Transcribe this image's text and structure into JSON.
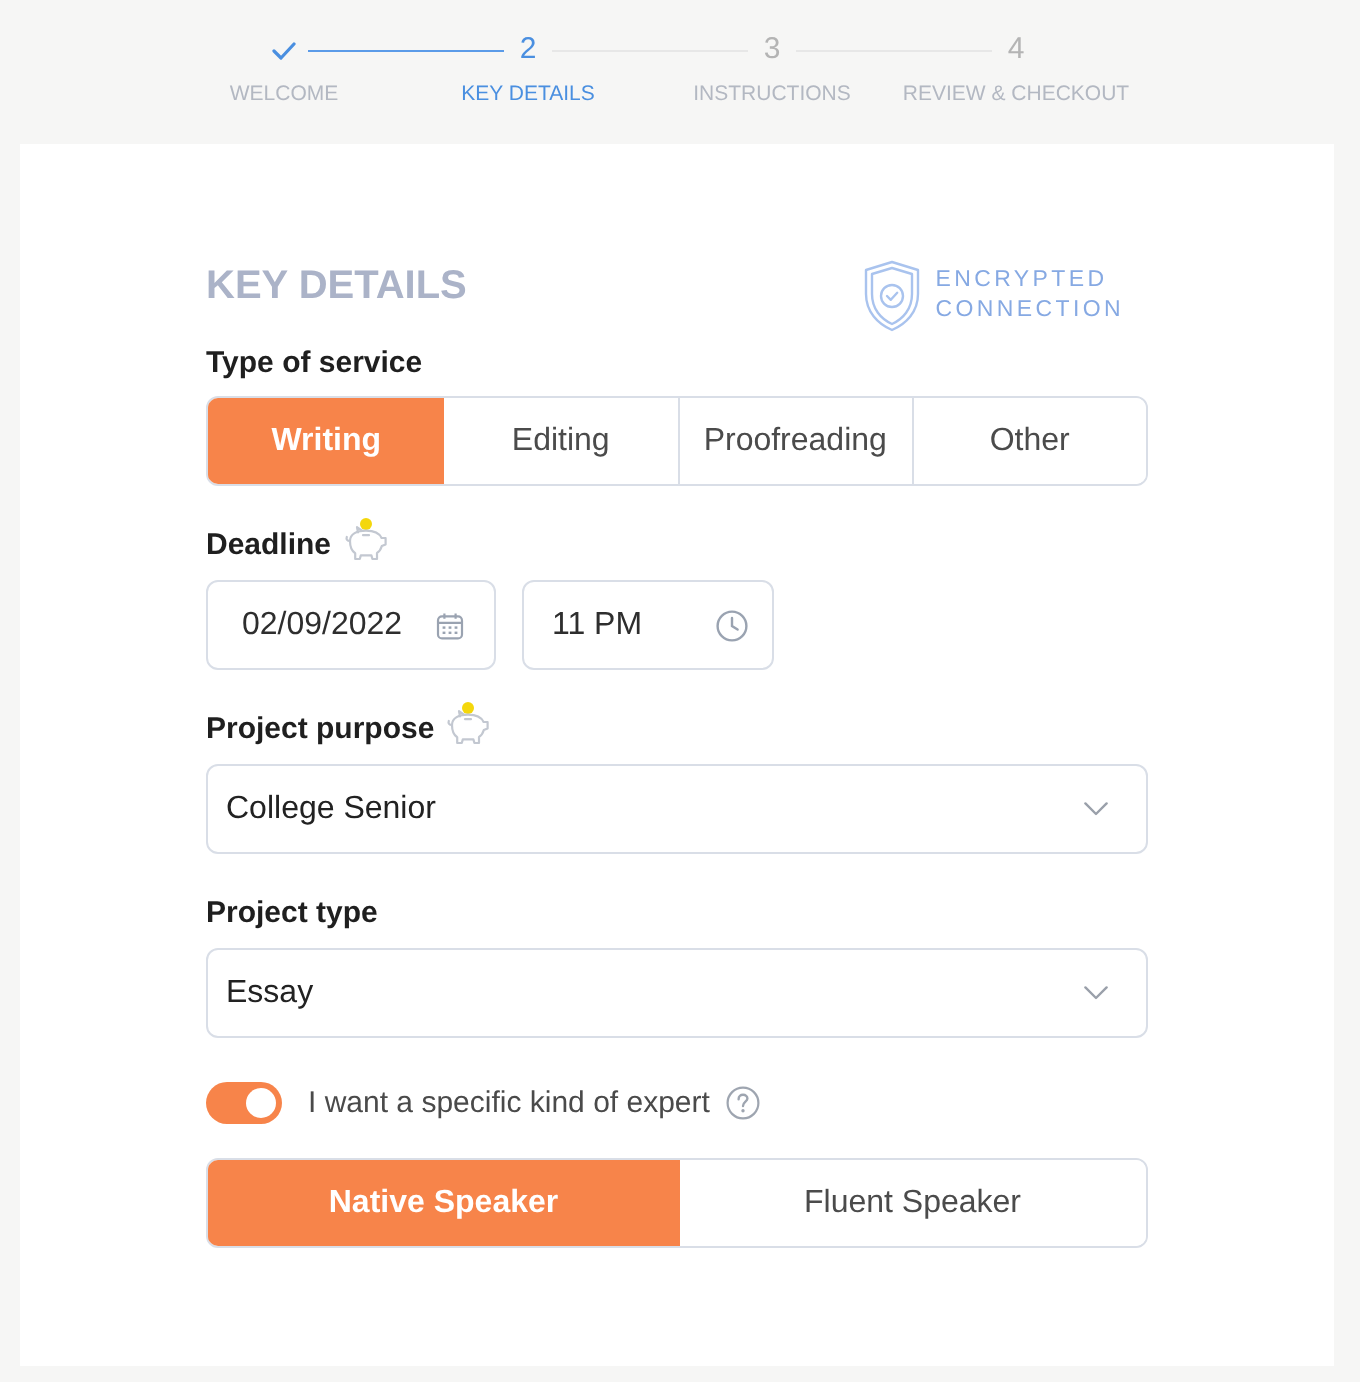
{
  "stepper": {
    "steps": [
      {
        "label": "WELCOME",
        "completed": true,
        "selected": false
      },
      {
        "number": "2",
        "label": "KEY DETAILS",
        "completed": false,
        "selected": true
      },
      {
        "number": "3",
        "label": "INSTRUCTIONS",
        "completed": false,
        "selected": false
      },
      {
        "number": "4",
        "label": "REVIEW & CHECKOUT",
        "completed": false,
        "selected": false
      }
    ]
  },
  "form": {
    "title": "KEY DETAILS",
    "security_badge": "ENCRYPTED CONNECTION",
    "service_type": {
      "label": "Type of service",
      "options": [
        {
          "label": "Writing",
          "selected": true
        },
        {
          "label": "Editing",
          "selected": false
        },
        {
          "label": "Proofreading",
          "selected": false
        },
        {
          "label": "Other",
          "selected": false
        }
      ]
    },
    "deadline": {
      "label": "Deadline",
      "date": "02/09/2022",
      "time": "11 PM"
    },
    "project_purpose": {
      "label": "Project purpose",
      "value": "College Senior"
    },
    "project_type": {
      "label": "Project type",
      "value": "Essay"
    },
    "expert": {
      "toggle_label": "I want a specific kind of expert",
      "on": true,
      "options": [
        {
          "label": "Native Speaker",
          "selected": true
        },
        {
          "label": "Fluent Speaker",
          "selected": false
        }
      ]
    }
  }
}
